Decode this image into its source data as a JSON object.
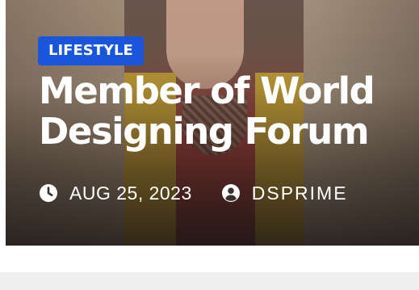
{
  "post": {
    "category": "LIFESTYLE",
    "title": "Member of World Designing Forum",
    "date": "AUG 25, 2023",
    "author": "DSPRIME"
  },
  "colors": {
    "category_bg": "#1a56db",
    "text": "#ffffff",
    "strip_bg": "#efefef"
  },
  "icons": {
    "date": "clock-icon",
    "author": "user-circle-icon"
  }
}
